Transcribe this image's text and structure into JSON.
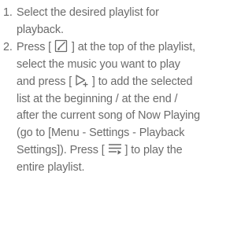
{
  "steps": [
    {
      "number": "1.",
      "text": "Select the desired playlist for playback."
    },
    {
      "number": "2.",
      "text_1": "Press [",
      "icon_1": "edit-icon",
      "text_2": "] at the top of the playlist, select the music you want to play and press [",
      "icon_2": "add-to-queue-icon",
      "text_3": "] to add the selected list at the beginning / at the end / after the current song of Now Playing (go to [Menu - Settings - Playback Settings]). Press [",
      "icon_3": "play-list-icon",
      "text_4": "] to play the entire playlist."
    }
  ]
}
